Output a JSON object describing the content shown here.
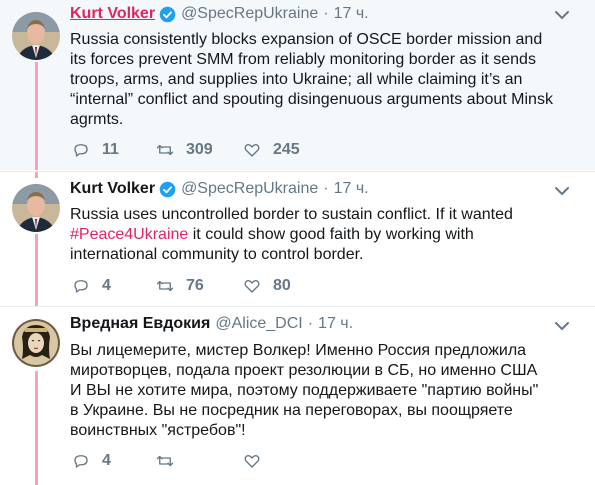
{
  "tweets": [
    {
      "author_name": "Kurt Volker",
      "verified": true,
      "handle": "@SpecRepUkraine",
      "separator": "·",
      "time": "17 ч.",
      "text_lines": [
        "Russia consistently blocks expansion of OSCE border mission and",
        "its forces prevent SMM from reliably monitoring border as it sends",
        "troops, arms, and supplies into Ukraine; all while claiming it’s an",
        "“internal” conflict and spouting disingenuous arguments about Minsk",
        "agrmts."
      ],
      "replies": "11",
      "retweets": "309",
      "likes": "245"
    },
    {
      "author_name": "Kurt Volker",
      "verified": true,
      "handle": "@SpecRepUkraine",
      "separator": "·",
      "time": "17 ч.",
      "text_line1": "Russia uses uncontrolled border to sustain conflict. If it wanted",
      "hashtag": "#Peace4Ukraine",
      "text_line2_rest": " it could show good faith by working with",
      "text_line3": "international community to control border.",
      "replies": "4",
      "retweets": "76",
      "likes": "80"
    },
    {
      "author_name": "Вредная Евдокия",
      "verified": false,
      "handle": "@Alice_DCI",
      "separator": "·",
      "time": "17 ч.",
      "text_lines": [
        "Вы лицемерите, мистер Волкер!  Именно Россия предложила",
        "миротворцев, подала проект резолюции в СБ,  но именно США",
        "И ВЫ не хотите мира, поэтому поддерживаете \"партию войны\"",
        "в Украине. Вы не посредник на переговорах, вы поощряете",
        "воинствных  \"ястребов\"!"
      ],
      "replies": "4",
      "retweets": "",
      "likes": ""
    }
  ],
  "colors": {
    "thread_line": "#f6a2b9",
    "accent_pink": "#e0245e",
    "verified_blue": "#1da1f2",
    "muted": "#657786",
    "highlight_bg": "#f5f8fa"
  },
  "icons": [
    "reply-icon",
    "retweet-icon",
    "like-icon",
    "verified-badge-icon",
    "chevron-down-icon"
  ]
}
